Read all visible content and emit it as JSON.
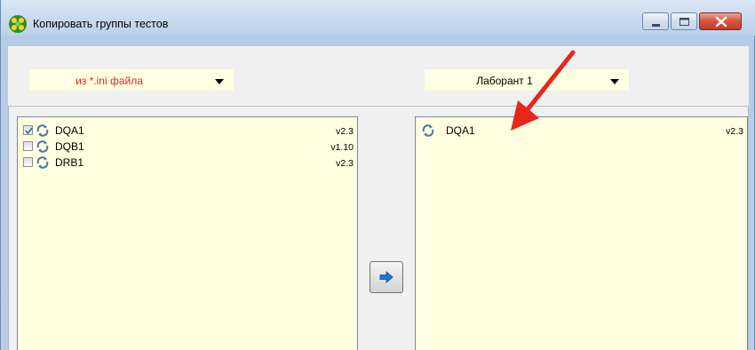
{
  "window": {
    "title": "Копировать группы тестов"
  },
  "source": {
    "selected": "из *.ini файла"
  },
  "target": {
    "selected": "Лаборант 1"
  },
  "left_list": {
    "items": [
      {
        "name": "DQA1",
        "version": "v2.3",
        "checked": true
      },
      {
        "name": "DQB1",
        "version": "v1.10",
        "checked": false
      },
      {
        "name": "DRB1",
        "version": "v2.3",
        "checked": false
      }
    ]
  },
  "right_list": {
    "items": [
      {
        "name": "DQA1",
        "version": "v2.3"
      }
    ]
  },
  "colors": {
    "list_background": "#ffffe1",
    "source_text": "#e8261b",
    "annotation_arrow": "#e8261b",
    "transfer_arrow": "#1e73d8"
  }
}
